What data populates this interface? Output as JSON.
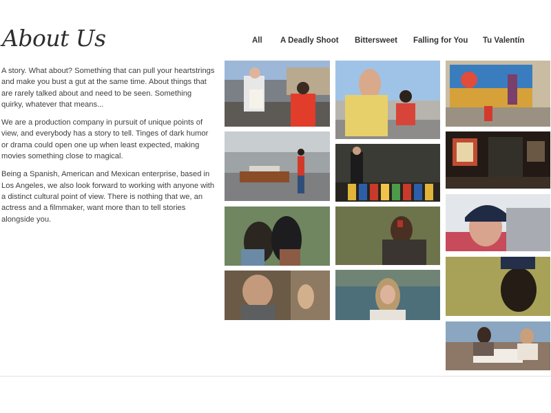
{
  "page": {
    "title": "About Us"
  },
  "nav": {
    "items": [
      "All",
      "A Deadly Shoot",
      "Bittersweet",
      "Falling for You",
      "Tu Valentín"
    ]
  },
  "about": {
    "paragraphs": [
      "A story. What about? Something that can pull your heartstrings and make you bust a gut at the same time. About things that are rarely talked about and need to be seen. Something quirky, whatever that means...",
      "We are a production company in pursuit of unique points of view, and everybody has a story to tell. Tinges of dark humor or drama could open one up when least expected, making movies something close to magical.",
      "Being a Spanish, American and Mexican enterprise, based in Los Angeles, we also look forward to working with anyone with a distinct cultural point of view. There is nothing that we, an actress and a filmmaker, want more than to tell stories alongside you."
    ]
  },
  "gallery": {
    "items": [
      {
        "scene": "man-with-sign-street"
      },
      {
        "scene": "man-sitting-car-hood"
      },
      {
        "scene": "mural-wall"
      },
      {
        "scene": "man-lying-on-coffin"
      },
      {
        "scene": "man-by-colorful-fence"
      },
      {
        "scene": "doorway-night"
      },
      {
        "scene": "two-people-in-trees"
      },
      {
        "scene": "man-bloody-face-woods"
      },
      {
        "scene": "woman-in-beanie"
      },
      {
        "scene": "smiling-man-interior"
      },
      {
        "scene": "woman-by-lake"
      },
      {
        "scene": "man-in-cap-backlit"
      },
      {
        "scene": "couple-at-restaurant-table"
      }
    ]
  }
}
